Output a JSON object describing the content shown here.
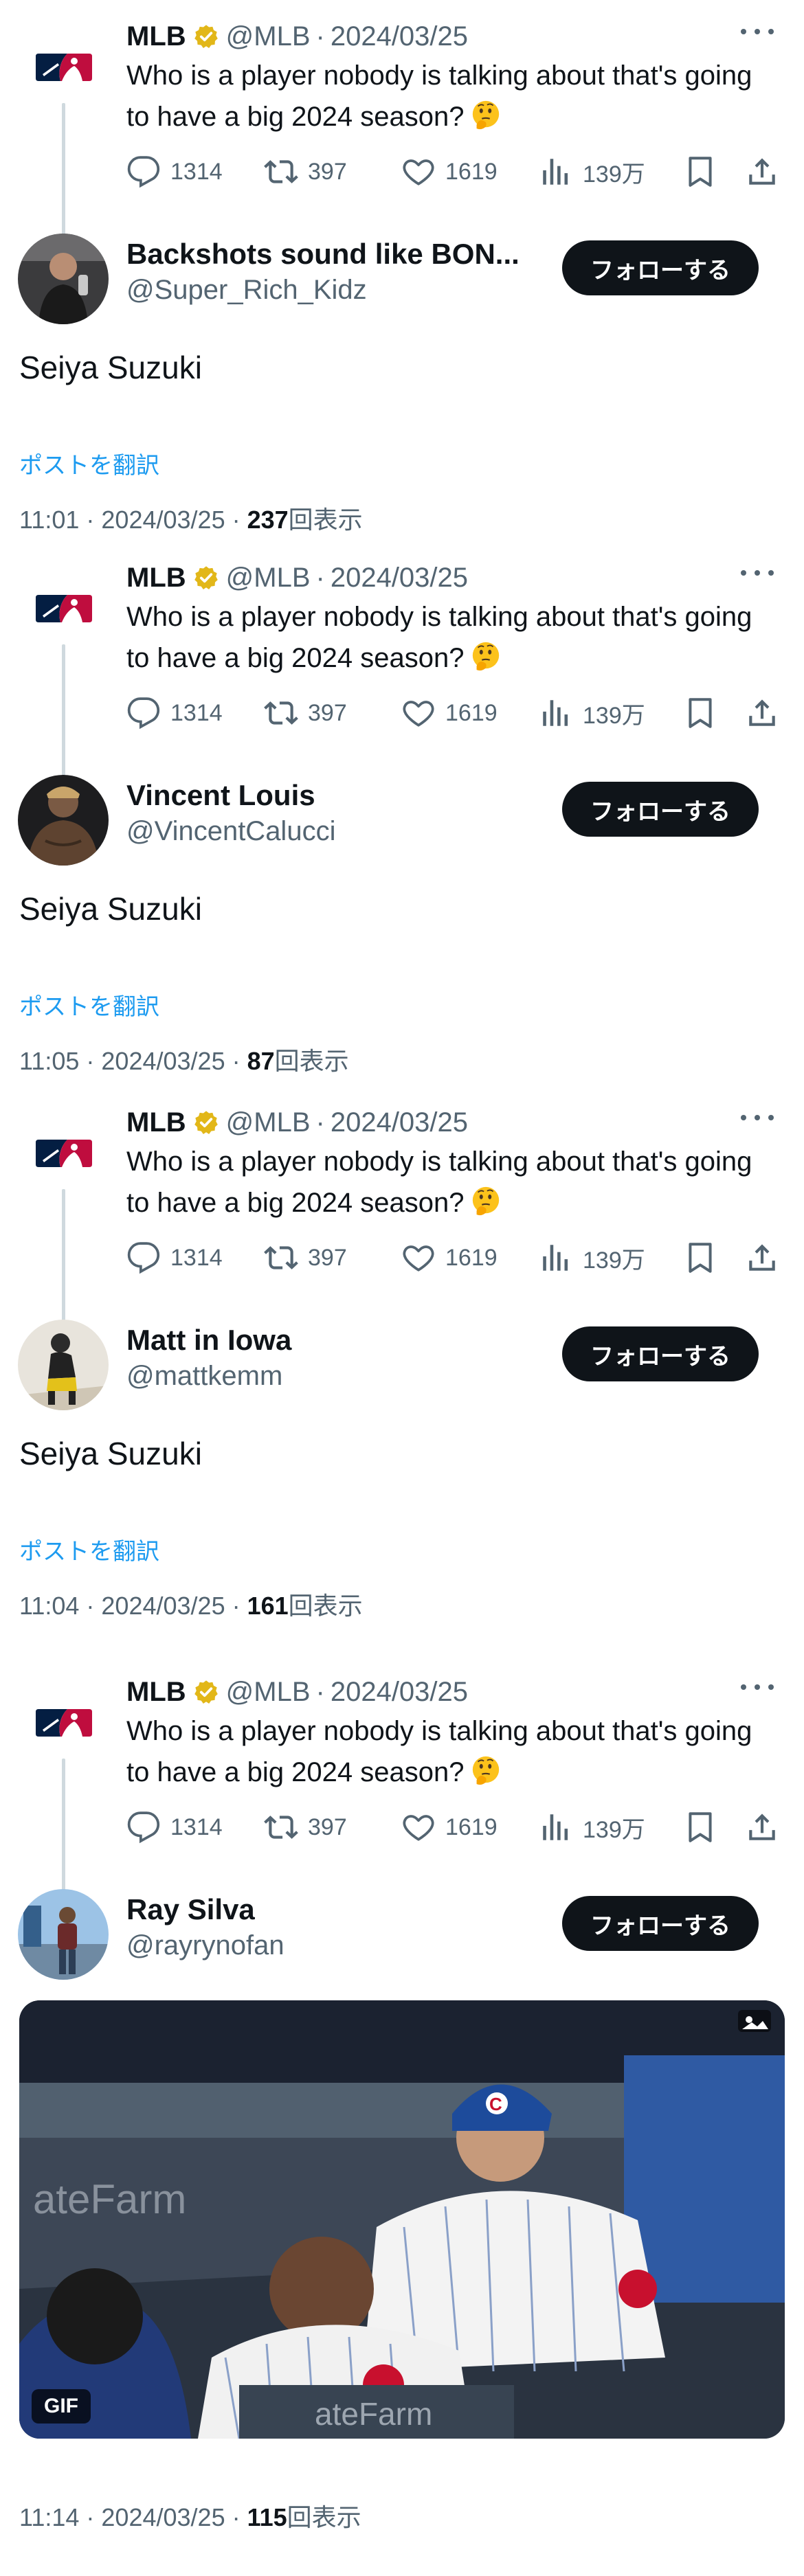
{
  "original_tweet": {
    "name": "MLB",
    "handle": "@MLB",
    "dot": "·",
    "date": "2024/03/25",
    "text": "Who is a player nobody is talking about that's going to have a big 2024 season?",
    "emoji_icon": "thinking-face-emoji",
    "stats": {
      "replies": "1314",
      "retweets": "397",
      "likes": "1619",
      "views": "139万"
    }
  },
  "follow_label": "フォローする",
  "translate_label": "ポストを翻訳",
  "views_suffix": "回表示",
  "replies": [
    {
      "name": "Backshots sound like BON...",
      "handle": "@Super_Rich_Kidz",
      "text": "Seiya Suzuki",
      "time": "11:01 · 2024/03/25 · ",
      "views": "237"
    },
    {
      "name": "Vincent Louis",
      "handle": "@VincentCalucci",
      "text": "Seiya Suzuki",
      "time": "11:05 · 2024/03/25 · ",
      "views": "87"
    },
    {
      "name": "Matt in Iowa",
      "handle": "@mattkemm",
      "text": "Seiya Suzuki",
      "time": "11:04 · 2024/03/25 · ",
      "views": "161"
    },
    {
      "name": "Ray Silva",
      "handle": "@rayrynofan",
      "media_badge": "GIF",
      "time": "11:14 · 2024/03/25 · ",
      "views": "115"
    }
  ],
  "colors": {
    "text": "#0f1419",
    "secondary": "#536471",
    "link": "#1d9bf0",
    "verified": "#e2b719",
    "mlb_blue": "#041e42",
    "mlb_red": "#bf0d3e"
  }
}
